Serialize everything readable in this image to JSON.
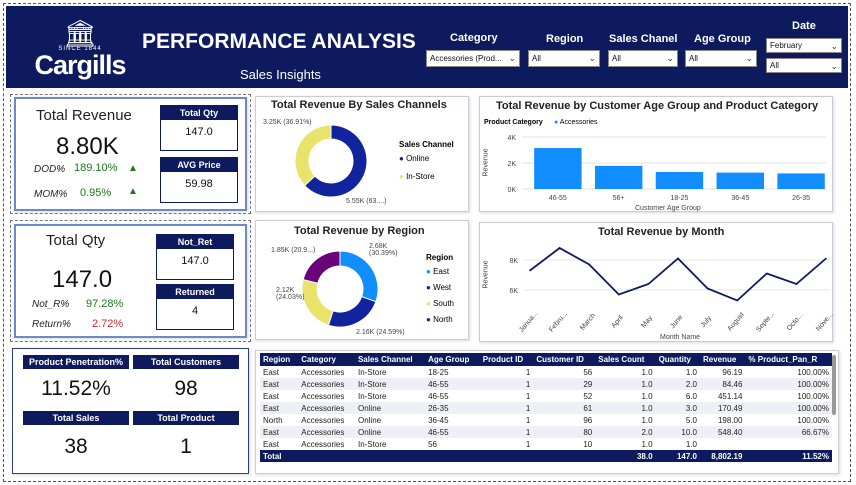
{
  "brand": {
    "since": "SINCE 1844",
    "name": "Cargills"
  },
  "header": {
    "title": "PERFORMANCE ANALYSIS",
    "subtitle": "Sales Insights"
  },
  "filters": {
    "category": {
      "label": "Category",
      "value": "Accessories (Prod..."
    },
    "region": {
      "label": "Region",
      "value": "All"
    },
    "sales_channel": {
      "label": "Sales Chanel",
      "value": "All"
    },
    "age_group": {
      "label": "Age Group",
      "value": "All"
    },
    "date": {
      "label": "Date",
      "month": "February",
      "day": "All"
    }
  },
  "revenue_card": {
    "title": "Total Revenue",
    "value": "8.80K",
    "dod_label": "DOD%",
    "dod_value": "189.10%",
    "mom_label": "MOM%",
    "mom_value": "0.95%",
    "qty_title": "Total Qty",
    "qty_value": "147.0",
    "avg_title": "AVG Price",
    "avg_value": "59.98"
  },
  "qty_card": {
    "title": "Total Qty",
    "value": "147.0",
    "notr_label": "Not_R%",
    "notr_value": "97.28%",
    "ret_label": "Return%",
    "ret_value": "2.72%",
    "notret_title": "Not_Ret",
    "notret_value": "147.0",
    "returned_title": "Returned",
    "returned_value": "4"
  },
  "mini_kpis": {
    "penetration": {
      "title": "Product Penetration%",
      "value": "11.52%"
    },
    "customers": {
      "title": "Total Customers",
      "value": "98"
    },
    "sales": {
      "title": "Total Sales",
      "value": "38"
    },
    "products": {
      "title": "Total Product",
      "value": "1"
    }
  },
  "colors": {
    "navy": "#0d1b5e",
    "blue": "#118dff",
    "darkblue": "#12239e",
    "yellow": "#e8e36b",
    "purple": "#6b007b",
    "green": "#1a7a1a",
    "red": "#d62728"
  },
  "chart_data": [
    {
      "type": "pie",
      "title": "Total Revenue By Sales Channels",
      "legend_title": "Sales Channel",
      "categories": [
        "Online",
        "In-Store"
      ],
      "values": [
        5550,
        3250
      ],
      "labels": [
        "5.55K (63....)",
        "3.25K (36.91%)"
      ]
    },
    {
      "type": "bar",
      "title": "Total Revenue by Customer Age Group and Product Category",
      "legend_title": "Product Category",
      "series_name": "Accessories",
      "categories": [
        "46-55",
        "56+",
        "18-25",
        "36-45",
        "26-35"
      ],
      "values": [
        3150,
        1780,
        1310,
        1260,
        1200
      ],
      "xlabel": "Customer Age Group",
      "ylabel": "Revenue",
      "yticks": [
        "0K",
        "2K",
        "4K"
      ],
      "ylim": [
        0,
        4000
      ]
    },
    {
      "type": "pie",
      "title": "Total Revenue by Region",
      "legend_title": "Region",
      "categories": [
        "East",
        "West",
        "South",
        "North"
      ],
      "values": [
        2680,
        2160,
        2120,
        1850
      ],
      "labels": [
        "2.68K (30.39%)",
        "2.16K (24.59%)",
        "2.12K (24.03%)",
        "1.85K (20.9...)"
      ]
    },
    {
      "type": "line",
      "title": "Total Revenue by Month",
      "categories": [
        "Janua...",
        "Febru...",
        "March",
        "April",
        "May",
        "June",
        "July",
        "August",
        "Septe...",
        "Octo...",
        "Nove..."
      ],
      "values": [
        7300,
        8800,
        7700,
        5700,
        6400,
        8100,
        6100,
        5300,
        7100,
        6400,
        8100
      ],
      "xlabel": "Month  Name",
      "ylabel": "Revenue",
      "yticks": [
        "6K",
        "8K"
      ],
      "ylim": [
        5000,
        9000
      ]
    }
  ],
  "table": {
    "columns": [
      "Region",
      "Category",
      "Sales Channel",
      "Age Group",
      "Product ID",
      "Customer ID",
      "Sales Count",
      "Quantity",
      "Revenue",
      "% Product_Pan_R"
    ],
    "rows": [
      [
        "East",
        "Accessories",
        "In-Store",
        "18-25",
        "1",
        "56",
        "1.0",
        "1.0",
        "96.19",
        "100.00%"
      ],
      [
        "East",
        "Accessories",
        "In-Store",
        "46-55",
        "1",
        "29",
        "1.0",
        "2.0",
        "84.46",
        "100.00%"
      ],
      [
        "East",
        "Accessories",
        "In-Store",
        "46-55",
        "1",
        "52",
        "1.0",
        "6.0",
        "451.14",
        "100.00%"
      ],
      [
        "East",
        "Accessories",
        "Online",
        "26-35",
        "1",
        "61",
        "1.0",
        "3.0",
        "170.49",
        "100.00%"
      ],
      [
        "North",
        "Accessories",
        "Online",
        "36-45",
        "1",
        "96",
        "1.0",
        "5.0",
        "198.00",
        "100.00%"
      ],
      [
        "East",
        "Accessories",
        "Online",
        "46-55",
        "1",
        "80",
        "2.0",
        "10.0",
        "548.40",
        "66.67%"
      ],
      [
        "East",
        "Accessories",
        "In-Store",
        "56",
        "1",
        "10",
        "1.0",
        "1.0",
        "",
        ""
      ]
    ],
    "total": [
      "Total",
      "",
      "",
      "",
      "",
      "",
      "38.0",
      "147.0",
      "8,802.19",
      "11.52%"
    ]
  }
}
